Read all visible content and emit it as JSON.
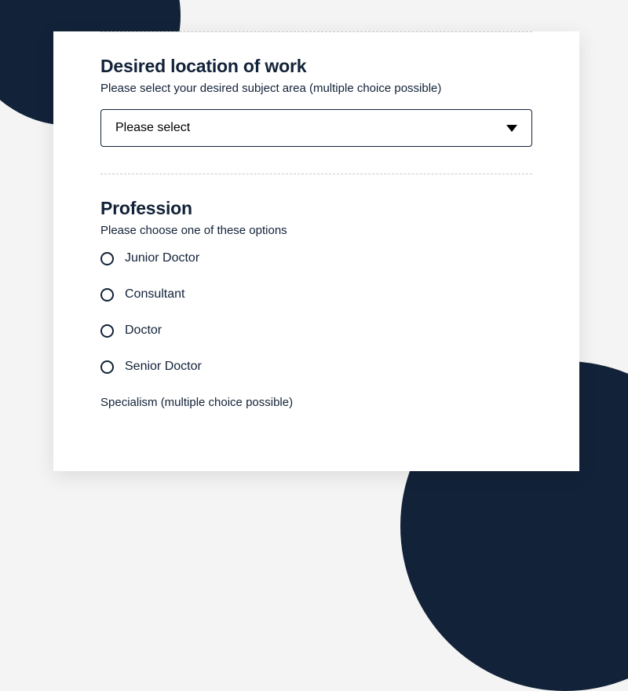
{
  "location": {
    "title": "Desired location of work",
    "help": "Please select your desired subject area (multiple choice possible)",
    "placeholder": "Please select"
  },
  "profession": {
    "title": "Profession",
    "help": "Please choose one of these options",
    "options": [
      {
        "label": "Junior Doctor"
      },
      {
        "label": "Consultant"
      },
      {
        "label": "Doctor"
      },
      {
        "label": "Senior Doctor"
      }
    ],
    "specialism_label": "Specialism (multiple choice possible)"
  }
}
